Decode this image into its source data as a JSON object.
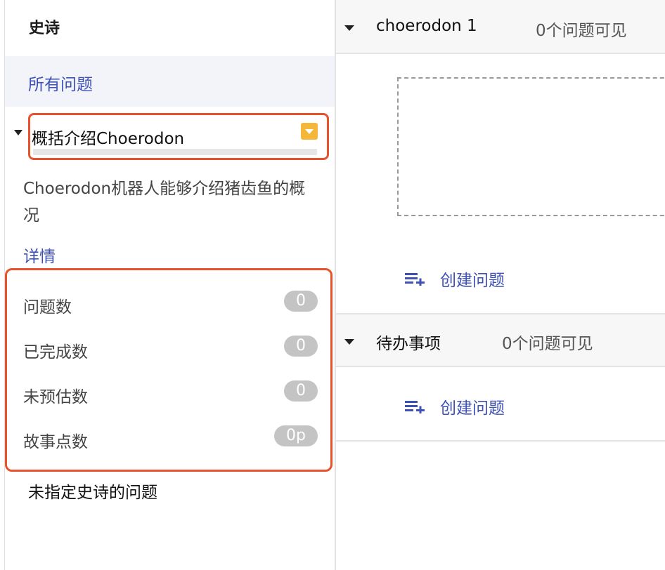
{
  "sidebar": {
    "title": "史诗",
    "all_issues": "所有问题",
    "epic": {
      "name": "概括介绍Choerodon",
      "description": "Choerodon机器人能够介绍猪齿鱼的概况",
      "details_link": "详情",
      "progress": 0,
      "dropdown_color": "#f4b73a",
      "stats": [
        {
          "label": "问题数",
          "value": "0"
        },
        {
          "label": "已完成数",
          "value": "0"
        },
        {
          "label": "未预估数",
          "value": "0"
        },
        {
          "label": "故事点数",
          "value": "0p"
        }
      ]
    },
    "unassigned": "未指定史诗的问题"
  },
  "main": {
    "sprints": [
      {
        "title": "choerodon 1",
        "count": "0个问题可见",
        "create_label": "创建问题"
      },
      {
        "title": "待办事项",
        "count": "0个问题可见",
        "create_label": "创建问题"
      }
    ]
  },
  "colors": {
    "accent": "#3f51b5",
    "highlight": "#e8532d"
  }
}
